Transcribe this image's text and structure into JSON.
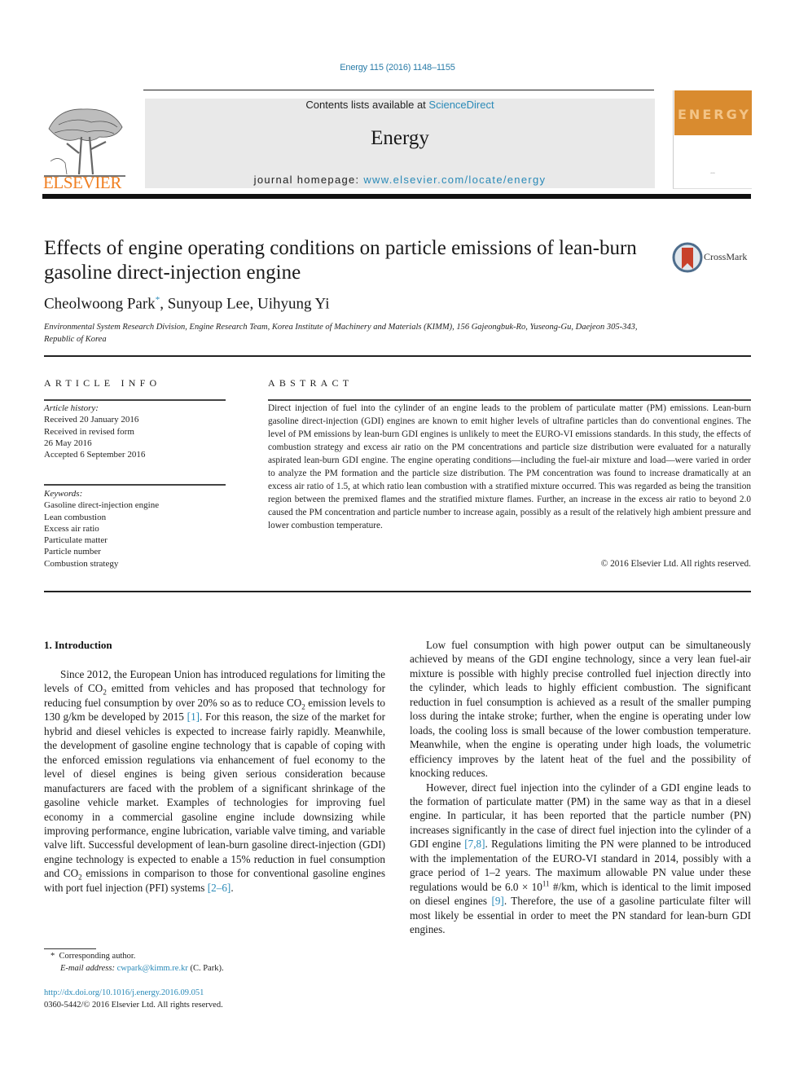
{
  "header": {
    "citation": "Energy 115 (2016) 1148–1155",
    "contents_prefix": "Contents lists available at ",
    "contents_link": "ScienceDirect",
    "journal_name": "Energy",
    "homepage_prefix": "journal homepage: ",
    "homepage_link": "www.elsevier.com/locate/energy",
    "publisher_logo_text": "ELSEVIER",
    "cover_title": "ENERGY",
    "brand_colors": {
      "elsevier_orange": "#f07f21",
      "link_blue": "#2a8ab8",
      "cover_orange": "#d98b2f"
    }
  },
  "article": {
    "title": "Effects of engine operating conditions on particle emissions of lean-burn gasoline direct-injection engine",
    "crossmark_label": "CrossMark",
    "authors": [
      {
        "name": "Cheolwoong Park",
        "mark": "*"
      },
      {
        "name": "Sunyoup Lee",
        "mark": ""
      },
      {
        "name": "Uihyung Yi",
        "mark": ""
      }
    ],
    "affiliation": "Environmental System Research Division, Engine Research Team, Korea Institute of Machinery and Materials (KIMM), 156 Gajeongbuk-Ro, Yuseong-Gu, Daejeon 305-343, Republic of Korea"
  },
  "article_info": {
    "heading": "ARTICLE INFO",
    "history_label": "Article history:",
    "history": [
      "Received 20 January 2016",
      "Received in revised form",
      "26 May 2016",
      "Accepted 6 September 2016"
    ],
    "keywords_label": "Keywords:",
    "keywords": [
      "Gasoline direct-injection engine",
      "Lean combustion",
      "Excess air ratio",
      "Particulate matter",
      "Particle number",
      "Combustion strategy"
    ]
  },
  "abstract": {
    "heading": "ABSTRACT",
    "text": "Direct injection of fuel into the cylinder of an engine leads to the problem of particulate matter (PM) emissions. Lean-burn gasoline direct-injection (GDI) engines are known to emit higher levels of ultrafine particles than do conventional engines. The level of PM emissions by lean-burn GDI engines is unlikely to meet the EURO-VI emissions standards. In this study, the effects of combustion strategy and excess air ratio on the PM concentrations and particle size distribution were evaluated for a naturally aspirated lean-burn GDI engine. The engine operating conditions—including the fuel-air mixture and load—were varied in order to analyze the PM formation and the particle size distribution. The PM concentration was found to increase dramatically at an excess air ratio of 1.5, at which ratio lean combustion with a stratified mixture occurred. This was regarded as being the transition region between the premixed flames and the stratified mixture flames. Further, an increase in the excess air ratio to beyond 2.0 caused the PM concentration and particle number to increase again, possibly as a result of the relatively high ambient pressure and lower combustion temperature.",
    "copyright": "© 2016 Elsevier Ltd. All rights reserved."
  },
  "body": {
    "section_heading": "1.  Introduction",
    "left_p1": {
      "a": "Since 2012, the European Union has introduced regulations for limiting the levels of CO",
      "b": " emitted from vehicles and has proposed that technology for reducing fuel consumption by over 20% so as to reduce CO",
      "c": " emission levels to 130 g/km be developed by 2015 ",
      "ref1": "[1]",
      "d": ". For this reason, the size of the market for hybrid and diesel vehicles is expected to increase fairly rapidly. Meanwhile, the development of gasoline engine technology that is capable of coping with the enforced emission regulations via enhancement of fuel economy to the level of diesel engines is being given serious consideration because manufacturers are faced with the problem of a significant shrinkage of the gasoline vehicle market. Examples of technologies for improving fuel economy in a commercial gasoline engine include downsizing while improving performance, engine lubrication, variable valve timing, and variable valve lift. Successful development of lean-burn gasoline direct-injection (GDI) engine technology is expected to enable a 15% reduction in fuel consumption and CO",
      "e": " emissions in comparison to those for conventional gasoline engines with port fuel injection (PFI) systems ",
      "ref2": "[2–6]",
      "f": ".",
      "sub": "2"
    },
    "right_p1": "Low fuel consumption with high power output can be simultaneously achieved by means of the GDI engine technology, since a very lean fuel-air mixture is possible with highly precise controlled fuel injection directly into the cylinder, which leads to highly efficient combustion. The significant reduction in fuel consumption is achieved as a result of the smaller pumping loss during the intake stroke; further, when the engine is operating under low loads, the cooling loss is small because of the lower combustion temperature. Meanwhile, when the engine is operating under high loads, the volumetric efficiency improves by the latent heat of the fuel and the possibility of knocking reduces.",
    "right_p2": {
      "a": "However, direct fuel injection into the cylinder of a GDI engine leads to the formation of particulate matter (PM) in the same way as that in a diesel engine. In particular, it has been reported that the particle number (PN) increases significantly in the case of direct fuel injection into the cylinder of a GDI engine ",
      "ref1": "[7,8]",
      "b": ". Regulations limiting the PN were planned to be introduced with the implementation of the EURO-VI standard in 2014, possibly with a grace period of 1–2 years. The maximum allowable PN value under these regulations would be 6.0 × 10",
      "exp": "11",
      "c": " #/km, which is identical to the limit imposed on diesel engines ",
      "ref2": "[9]",
      "d": ". Therefore, the use of a gasoline particulate filter will most likely be essential in order to meet the PN standard for lean-burn GDI engines."
    }
  },
  "footnote": {
    "mark": "*",
    "corresponding": "Corresponding author.",
    "email_label": "E-mail address:",
    "email": "cwpark@kimm.re.kr",
    "email_suffix": " (C. Park).",
    "doi": "http://dx.doi.org/10.1016/j.energy.2016.09.051",
    "issn_copyright": "0360-5442/© 2016 Elsevier Ltd. All rights reserved."
  }
}
